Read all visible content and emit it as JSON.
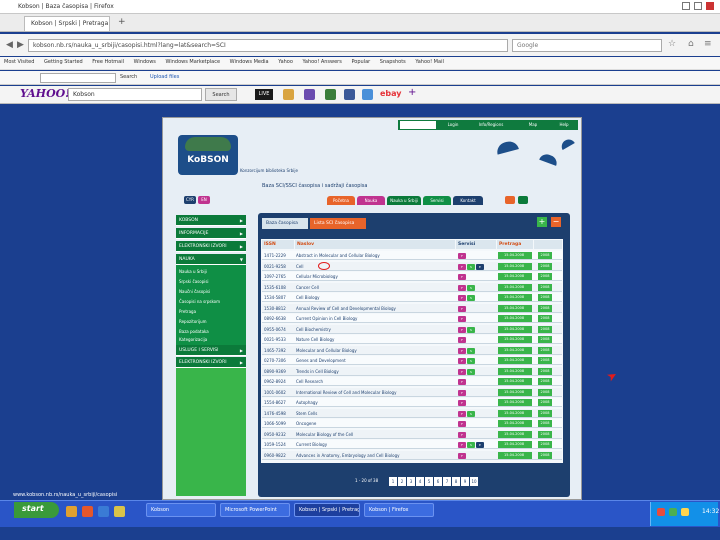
{
  "browser": {
    "title": "Kobson | Baza časopisa | Firefox",
    "tabs": [
      "Kobson | Srpski | Pretraga",
      "+"
    ],
    "url": "kobson.nb.rs/nauka_u_srbiji/casopisi.html?lang=lat&search=SCI",
    "search_placeholder": "Google",
    "bookmarks": [
      "Most Visited",
      "Getting Started",
      "Free Hotmail",
      "Windows",
      "Windows Marketplace",
      "Windows Media",
      "Yahoo",
      "Yahoo! Answers",
      "Popular",
      "Snapshots",
      "Yahoo! Mail"
    ],
    "link_field": "",
    "link_label": "Search",
    "upload_label": "Upload files"
  },
  "yahoo_bar": {
    "logo": "YAHOO!",
    "search_value": "Kobson",
    "search_button": "Search",
    "live_label": "LIVE",
    "ebay_label": "ebay"
  },
  "site": {
    "top_nav": [
      "Login",
      "Info/Regions",
      "Map",
      "Help"
    ],
    "logo_text": "KoBSON",
    "logo_caption": "Konzorcijum biblioteka Srbije",
    "subtitle": "Baza SCI/SSCI časopisa i sadržaji časopisa",
    "languages": [
      "CYR",
      "EN"
    ],
    "page_tabs": [
      "Početna",
      "Nauka",
      "Nauka u Srbiji",
      "Servisi",
      "Kontakt"
    ],
    "accent_green": "#0b7a3a",
    "accent_orange": "#e8642a",
    "accent_navy": "#1d3f6e"
  },
  "sidebar": {
    "items": [
      "KOBSON",
      "INFORMACIJE",
      "ELEKTRONSKI IZVORI",
      "NAUKA"
    ],
    "sub_items": [
      "Nauka u Srbiji",
      "Srpski časopisi",
      "Naučni časopisi",
      "Časopisi na srpskom",
      "Pretraga",
      "Repozitorijum",
      "Baza podataka",
      "Kategorizacija"
    ],
    "lower_items": [
      "USLUGE I SERVISI",
      "ELEKTRONSKI IZVORI"
    ]
  },
  "panel": {
    "tab_active": "Baza časopisa",
    "tab_inactive": "Lista SCI časopisa",
    "columns": [
      "ISSN",
      "Naslov",
      "Servisi",
      "Pretraga",
      ""
    ],
    "rows": [
      {
        "issn": "1471-2229",
        "title": "Abstract in Molecular and Cellular Biology",
        "services": [
          "F"
        ],
        "date": "15.04.2008",
        "last": "2008"
      },
      {
        "issn": "0021-9258",
        "title": "Cell",
        "services": [
          "F",
          "S",
          "E"
        ],
        "date": "15.04.2008",
        "last": "2008"
      },
      {
        "issn": "1097-2765",
        "title": "Cellular Microbiology",
        "services": [
          "F"
        ],
        "date": "15.04.2008",
        "last": "2008"
      },
      {
        "issn": "1535-6108",
        "title": "Cancer Cell",
        "services": [
          "F",
          "S"
        ],
        "date": "15.04.2008",
        "last": "2008"
      },
      {
        "issn": "1534-5807",
        "title": "Cell Biology",
        "services": [
          "F",
          "S"
        ],
        "date": "15.04.2008",
        "last": "2008"
      },
      {
        "issn": "1530-8812",
        "title": "Annual Review of Cell and Developmental Biology",
        "services": [
          "F"
        ],
        "date": "15.04.2008",
        "last": "2008"
      },
      {
        "issn": "0892-6638",
        "title": "Current Opinion in Cell Biology",
        "services": [
          "F"
        ],
        "date": "15.04.2008",
        "last": "2008"
      },
      {
        "issn": "0955-0674",
        "title": "Cell Biochemistry",
        "services": [
          "F",
          "S"
        ],
        "date": "15.04.2008",
        "last": "2008"
      },
      {
        "issn": "0021-9533",
        "title": "Nature Cell Biology",
        "services": [
          "F"
        ],
        "date": "15.04.2008",
        "last": "2008"
      },
      {
        "issn": "1465-7392",
        "title": "Molecular and Cellular Biology",
        "services": [
          "F",
          "S"
        ],
        "date": "15.04.2008",
        "last": "2008"
      },
      {
        "issn": "0270-7306",
        "title": "Genes and Development",
        "services": [
          "F",
          "S"
        ],
        "date": "15.04.2008",
        "last": "2008"
      },
      {
        "issn": "0890-9369",
        "title": "Trends in Cell Biology",
        "services": [
          "F",
          "S"
        ],
        "date": "15.04.2008",
        "last": "2008"
      },
      {
        "issn": "0962-8924",
        "title": "Cell Research",
        "services": [
          "F"
        ],
        "date": "15.04.2008",
        "last": "2008"
      },
      {
        "issn": "1001-0602",
        "title": "International Review of Cell and Molecular Biology",
        "services": [
          "F"
        ],
        "date": "15.04.2008",
        "last": "2008"
      },
      {
        "issn": "1554-8627",
        "title": "Autophagy",
        "services": [
          "F"
        ],
        "date": "15.04.2008",
        "last": "2008"
      },
      {
        "issn": "1476-4598",
        "title": "Stem Cells",
        "services": [
          "F",
          "S"
        ],
        "date": "15.04.2008",
        "last": "2008"
      },
      {
        "issn": "1066-5099",
        "title": "Oncogene",
        "services": [
          "F"
        ],
        "date": "15.04.2008",
        "last": "2008"
      },
      {
        "issn": "0950-9232",
        "title": "Molecular Biology of the Cell",
        "services": [
          "F"
        ],
        "date": "15.04.2008",
        "last": "2008"
      },
      {
        "issn": "1059-1524",
        "title": "Current Biology",
        "services": [
          "F",
          "S",
          "E"
        ],
        "date": "15.04.2008",
        "last": "2008"
      },
      {
        "issn": "0960-9822",
        "title": "Advances in Anatomy, Embryology and Cell Biology",
        "services": [
          "F"
        ],
        "date": "15.04.2008",
        "last": "2008"
      }
    ],
    "pager_label": "1 - 20 of 38",
    "pages": [
      "1",
      "2",
      "3",
      "4",
      "5",
      "6",
      "7",
      "8",
      "9",
      "10"
    ]
  },
  "status_url": "www.kobson.nb.rs/nauka_u_srbiji/casopisi",
  "taskbar": {
    "start": "start",
    "tasks": [
      "Kobson",
      "Microsoft PowerPoint",
      "Kobson | Srpski | Pretraga",
      "Kobson | Firefox"
    ],
    "clock": "14:32"
  }
}
